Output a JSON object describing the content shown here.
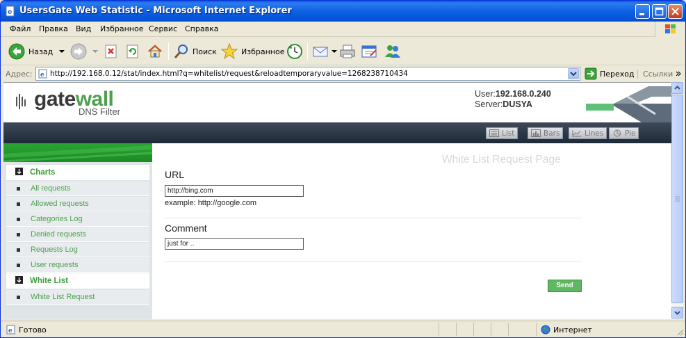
{
  "window": {
    "title": "UsersGate Web Statistic - Microsoft Internet Explorer"
  },
  "menu": {
    "items": [
      "Файл",
      "Правка",
      "Вид",
      "Избранное",
      "Сервис",
      "Справка"
    ]
  },
  "toolbar": {
    "back_label": "Назад",
    "search_label": "Поиск",
    "favorites_label": "Избранное"
  },
  "address": {
    "label": "Адрес:",
    "url": "http://192.168.0.12/stat/index.html?q=whitelist/request&reloadtemporaryvalue=1268238710434",
    "go_label": "Переход",
    "links_label": "Ссылки"
  },
  "status": {
    "text": "Готово",
    "zone": "Интернет"
  },
  "header": {
    "logo_gate": "gate",
    "logo_wall": "wall",
    "logo_sub": "DNS Filter",
    "user_label": "User:",
    "user_value": "192.168.0.240",
    "server_label": "Server:",
    "server_value": "DUSYA"
  },
  "view_buttons": [
    "List",
    "Bars",
    "Lines",
    "Pie"
  ],
  "sidebar": {
    "charts_section": "Charts",
    "chart_items": [
      "All requests",
      "Allowed requests",
      "Categories Log",
      "Denied requests",
      "Requests Log",
      "User requests"
    ],
    "whitelist_section": "White List",
    "whitelist_items": [
      "White List Request"
    ]
  },
  "main": {
    "heading": "White List Request Page",
    "url_label": "URL",
    "url_value": "http://bing.com",
    "url_hint": "example: http://google.com",
    "comment_label": "Comment",
    "comment_value": "just for ..",
    "send_label": "Send"
  },
  "colors": {
    "accent_green": "#4ea04e",
    "titlebar_blue": "#0a5fe0"
  }
}
